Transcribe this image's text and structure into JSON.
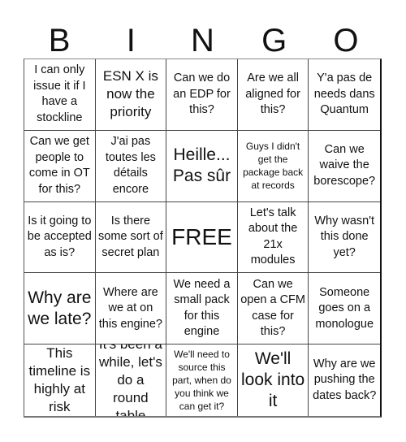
{
  "header": {
    "letters": [
      "B",
      "I",
      "N",
      "G",
      "O"
    ]
  },
  "cells": [
    [
      "I can only issue it if I have a stockline",
      "ESN X is now the priority",
      "Can we do an EDP for this?",
      "Are we all aligned for this?",
      "Y'a pas de needs dans Quantum"
    ],
    [
      "Can we get people to come in OT for this?",
      "J'ai pas toutes les détails encore",
      "Heille... Pas sûr",
      "Guys I didn't get the package back at records",
      "Can we waive the borescope?"
    ],
    [
      "Is it going to be accepted as is?",
      "Is there some sort of secret plan",
      "FREE",
      "Let's talk about the 21x modules",
      "Why wasn't this done yet?"
    ],
    [
      "Why are we late?",
      "Where are we at on this engine?",
      "We need a small pack for this engine",
      "Can we open a CFM case for this?",
      "Someone goes on a monologue"
    ],
    [
      "This timeline is highly at risk",
      "It's been a while, let's do a round table",
      "We'll need to source this part, when do you think we can get it?",
      "We'll look into it",
      "Why are we pushing the dates back?"
    ]
  ],
  "free_cell": {
    "row": 2,
    "col": 2,
    "label": "FREE"
  }
}
